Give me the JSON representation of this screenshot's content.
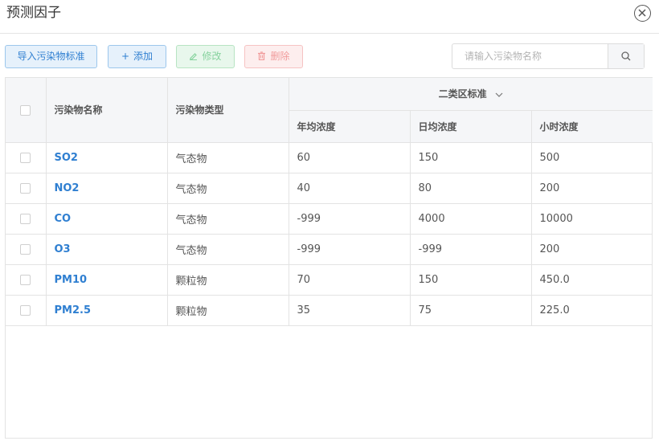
{
  "dialog": {
    "title": "预测因子"
  },
  "toolbar": {
    "import_label": "导入污染物标准",
    "add_label": "添加",
    "edit_label": "修改",
    "delete_label": "删除"
  },
  "search": {
    "placeholder": "请输入污染物名称",
    "value": ""
  },
  "table": {
    "headers": {
      "name": "污染物名称",
      "type": "污染物类型",
      "standard_group": "二类区标准",
      "annual": "年均浓度",
      "daily": "日均浓度",
      "hourly": "小时浓度"
    },
    "rows": [
      {
        "name": "SO2",
        "type": "气态物",
        "annual": "60",
        "daily": "150",
        "hourly": "500"
      },
      {
        "name": "NO2",
        "type": "气态物",
        "annual": "40",
        "daily": "80",
        "hourly": "200"
      },
      {
        "name": "CO",
        "type": "气态物",
        "annual": "-999",
        "daily": "4000",
        "hourly": "10000"
      },
      {
        "name": "O3",
        "type": "气态物",
        "annual": "-999",
        "daily": "-999",
        "hourly": "200"
      },
      {
        "name": "PM10",
        "type": "颗粒物",
        "annual": "70",
        "daily": "150",
        "hourly": "450.0"
      },
      {
        "name": "PM2.5",
        "type": "颗粒物",
        "annual": "35",
        "daily": "75",
        "hourly": "225.0"
      }
    ]
  },
  "icons": {
    "close": "close-circle-icon",
    "add": "plus-icon",
    "edit": "pencil-icon",
    "delete": "trash-icon",
    "search": "search-icon",
    "dropdown": "chevron-down-icon"
  },
  "colors": {
    "primary": "#2f7fd1",
    "success": "#88d39f",
    "danger": "#f19c9c",
    "header_bg": "#f5f6f8",
    "border": "#e3e3e3"
  }
}
